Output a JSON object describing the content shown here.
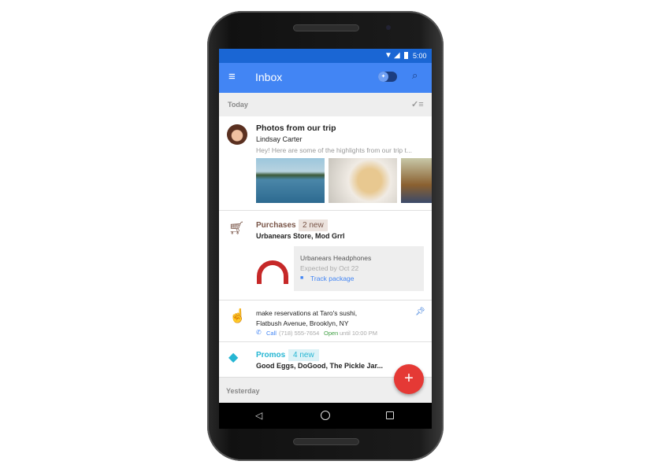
{
  "status": {
    "time": "5:00"
  },
  "appbar": {
    "title": "Inbox"
  },
  "sections": {
    "today": "Today",
    "yesterday": "Yesterday"
  },
  "email": {
    "subject": "Photos from our trip",
    "sender": "Lindsay Carter",
    "snippet": "Hey! Here are some of the highlights from our trip t..."
  },
  "purchases": {
    "label": "Purchases",
    "badge": "2 new",
    "senders": "Urbanears Store, Mod Grrl",
    "item": "Urbanears Headphones",
    "expected": "Expected by Oct 22",
    "track": "Track package"
  },
  "reminder": {
    "line1": "make reservations at Taro's sushi,",
    "line2": "Flatbush Avenue, Brooklyn, NY",
    "call": "Call",
    "phone": "(718) 555-7654",
    "open": "Open",
    "hours": "until 10:00 PM"
  },
  "promos": {
    "label": "Promos",
    "badge": "4 new",
    "senders": "Good Eggs, DoGood, The Pickle Jar..."
  },
  "colors": {
    "primary": "#4285f4",
    "statusbar": "#1a66d4",
    "fab": "#e53935",
    "purchases": "#795548",
    "promos": "#26b6d3"
  }
}
